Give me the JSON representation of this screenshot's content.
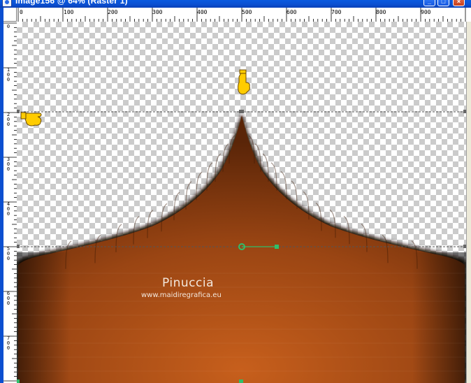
{
  "window": {
    "title": "Image156 @ 64% (Raster 1)",
    "buttons": {
      "minimize": "_",
      "maximize": "□",
      "close": "×"
    }
  },
  "rulers": {
    "horizontal_labels": [
      "0",
      "100",
      "200",
      "300",
      "400",
      "500",
      "600",
      "700",
      "800",
      "900"
    ],
    "vertical_labels": [
      "0",
      "100",
      "200",
      "300",
      "400",
      "500",
      "600",
      "700"
    ]
  },
  "watermark": {
    "title": "Pinuccia",
    "url": "www.maidiregrafica.eu"
  },
  "icons": {
    "pointing_hand_down": "hand-pointer-icon",
    "pointing_hand_right": "hand-pointer-icon",
    "handle_node": "node-handle-icon"
  },
  "colors": {
    "title_bar": "#0b4fd0",
    "shape_highlight": "#c8621e",
    "shape_edge": "#3a1a06",
    "handle": "#2fbf6a",
    "hand_yellow": "#ffcc00"
  }
}
